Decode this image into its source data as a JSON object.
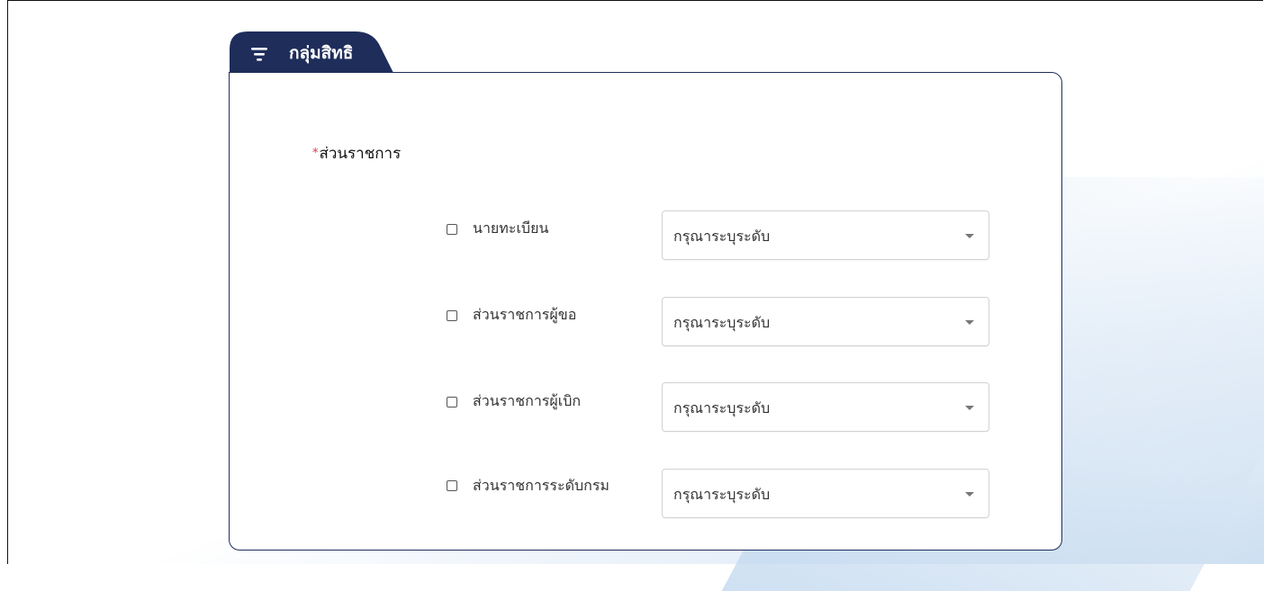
{
  "panel": {
    "tab_title": "กลุ่มสิทธิ",
    "tab_icon": "filter-icon"
  },
  "section": {
    "required_mark": "*",
    "label": "ส่วนราชการ"
  },
  "rows": [
    {
      "label": "นายทะเบียน",
      "checked": false,
      "select_placeholder": "กรุณาระบุระดับ"
    },
    {
      "label": "ส่วนราชการผู้ขอ",
      "checked": false,
      "select_placeholder": "กรุณาระบุระดับ"
    },
    {
      "label": "ส่วนราชการผู้เบิก",
      "checked": false,
      "select_placeholder": "กรุณาระบุระดับ"
    },
    {
      "label": "ส่วนราชการระดับกรม",
      "checked": false,
      "select_placeholder": "กรุณาระบุระดับ"
    }
  ],
  "colors": {
    "brand_navy": "#1f2d5b",
    "required_red": "#d9364a"
  }
}
